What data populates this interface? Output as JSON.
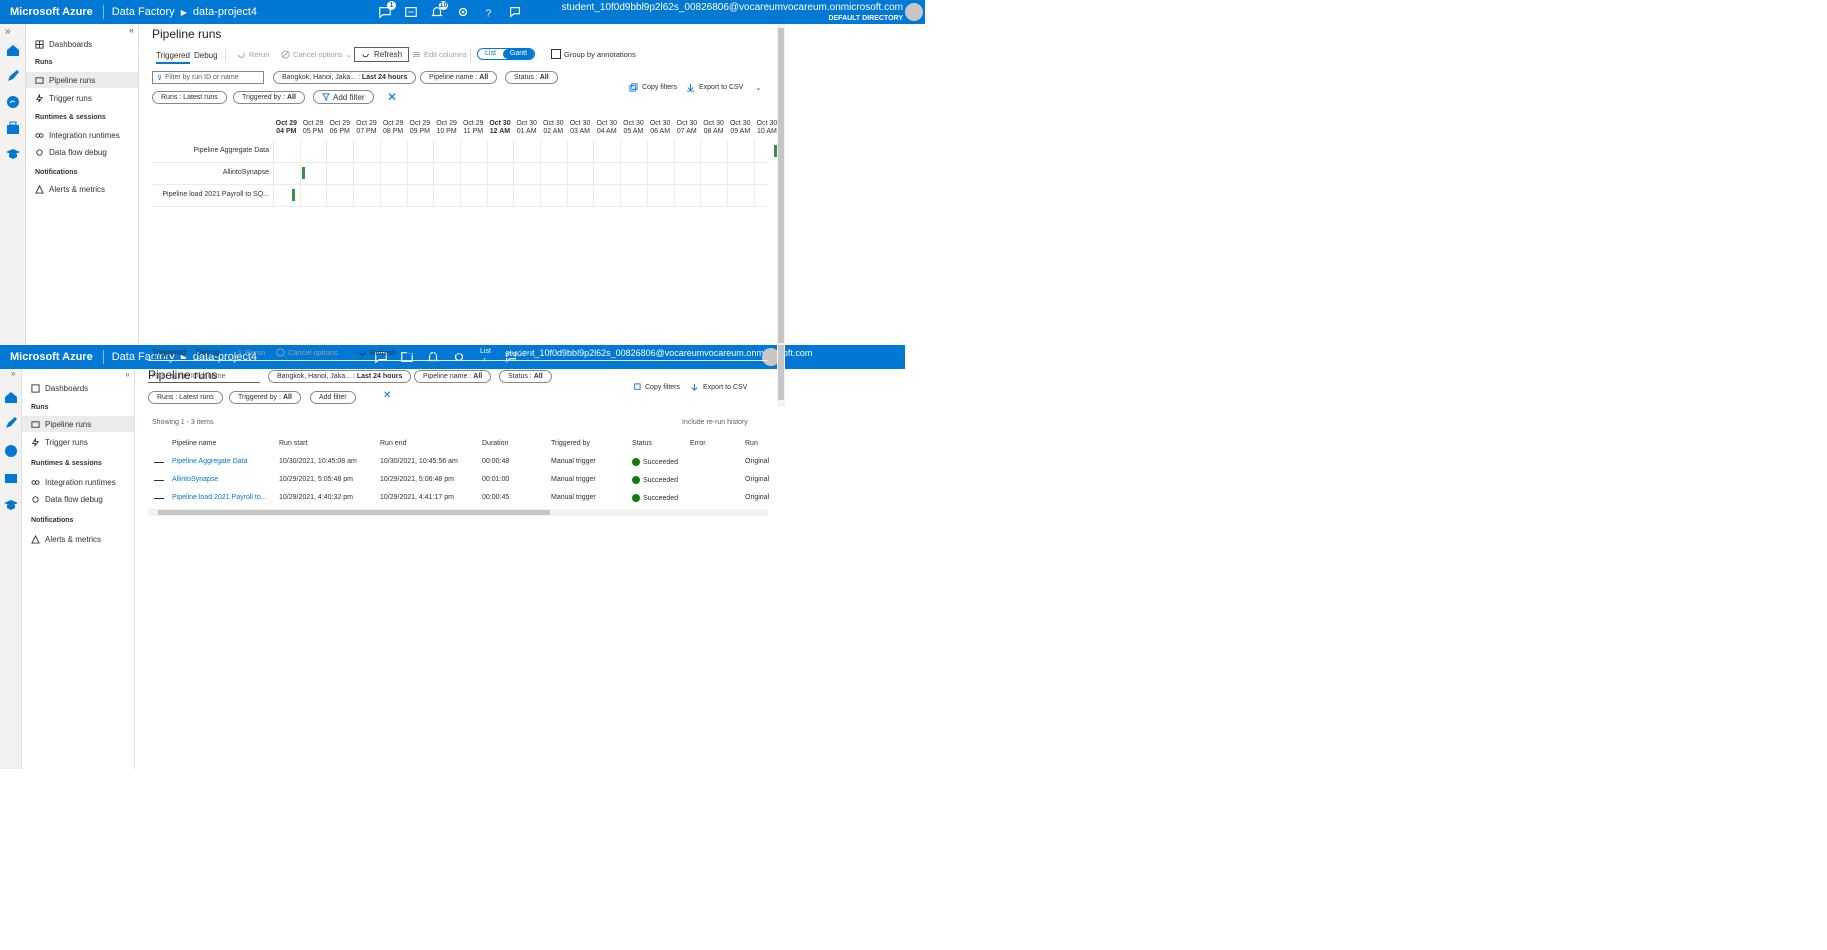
{
  "topbar": {
    "brand": "Microsoft Azure",
    "crumb1": "Data Factory",
    "crumb2": "data-project4",
    "badge_feedback": "1",
    "badge_notif": "10",
    "email": "student_10f0d9bbl9p2l62s_00826806@vocareumvocareum.onmicrosoft.com",
    "directory": "DEFAULT DIRECTORY",
    "color": "#0078d4"
  },
  "sidebar": {
    "dashboards": "Dashboards",
    "runs_group": "Runs",
    "pipeline_runs": "Pipeline runs",
    "trigger_runs": "Trigger runs",
    "runtimes_group": "Runtimes & sessions",
    "integration_runtimes": "Integration runtimes",
    "data_flow_debug": "Data flow debug",
    "notifications_group": "Notifications",
    "alerts_metrics": "Alerts & metrics"
  },
  "main": {
    "title": "Pipeline runs",
    "tab_triggered": "Triggered",
    "tab_debug": "Debug",
    "rerun": "Rerun",
    "cancel_options": "Cancel options",
    "refresh": "Refresh",
    "edit_columns": "Edit columns",
    "view_list": "List",
    "view_gantt": "Gantt",
    "group_by_annotations": "Group by annotations",
    "filter_placeholder": "Filter by run ID or name",
    "timezone_label": "Bangkok, Hanoi, Jaka... :",
    "timezone_value": "Last 24 hours",
    "pipeline_name_label": "Pipeline name :",
    "pipeline_name_value": "All",
    "status_label": "Status :",
    "status_value": "All",
    "runs_label": "Runs : Latest runs",
    "triggered_by_label": "Triggered by :",
    "triggered_by_value": "All",
    "add_filter": "Add filter",
    "copy_filters": "Copy filters",
    "export_csv": "Export to CSV"
  },
  "gantt": {
    "columns": [
      {
        "d": "Oct 29",
        "t": "04 PM",
        "bold": true
      },
      {
        "d": "Oct 29",
        "t": "05 PM"
      },
      {
        "d": "Oct 29",
        "t": "06 PM"
      },
      {
        "d": "Oct 29",
        "t": "07 PM"
      },
      {
        "d": "Oct 29",
        "t": "08 PM"
      },
      {
        "d": "Oct 29",
        "t": "09 PM"
      },
      {
        "d": "Oct 29",
        "t": "10 PM"
      },
      {
        "d": "Oct 29",
        "t": "11 PM"
      },
      {
        "d": "Oct 30",
        "t": "12 AM",
        "bold": true
      },
      {
        "d": "Oct 30",
        "t": "01 AM"
      },
      {
        "d": "Oct 30",
        "t": "02 AM"
      },
      {
        "d": "Oct 30",
        "t": "03 AM"
      },
      {
        "d": "Oct 30",
        "t": "04 AM"
      },
      {
        "d": "Oct 30",
        "t": "05 AM"
      },
      {
        "d": "Oct 30",
        "t": "06 AM"
      },
      {
        "d": "Oct 30",
        "t": "07 AM"
      },
      {
        "d": "Oct 30",
        "t": "08 AM"
      },
      {
        "d": "Oct 30",
        "t": "09 AM"
      },
      {
        "d": "Oct 30",
        "t": "10 AM"
      }
    ],
    "rows": [
      {
        "name": "Pipeline Aggregate Data",
        "start_hour": 18.75
      },
      {
        "name": "AllintoSynapse",
        "start_hour": 1.1
      },
      {
        "name": "Pipeline load 2021 Payroll to SQ...",
        "start_hour": 0.7
      }
    ],
    "bar_color": "#3d8d48"
  },
  "table": {
    "showing": "Showing 1 - 3 items",
    "headers": [
      "Pipeline name",
      "Run start",
      "Run end",
      "Duration",
      "Triggered by",
      "Status",
      "Error",
      "Run"
    ],
    "rows": [
      [
        "Pipeline Aggregate Data",
        "10/30/2021, 10:45:08 am",
        "10/30/2021, 10:45:56 am",
        "00:00:48",
        "Manual trigger",
        "Succeeded",
        "",
        "Original"
      ],
      [
        "AllintoSynapse",
        "10/29/2021, 5:05:48 pm",
        "10/29/2021, 5:06:48 pm",
        "00:01:00",
        "Manual trigger",
        "Succeeded",
        "",
        "Original"
      ],
      [
        "Pipeline load 2021 Payroll to...",
        "10/29/2021, 4:40:32 pm",
        "10/29/2021, 4:41:17 pm",
        "00:00:45",
        "Manual trigger",
        "Succeeded",
        "",
        "Original"
      ]
    ],
    "right_note": "Include re-run history"
  }
}
